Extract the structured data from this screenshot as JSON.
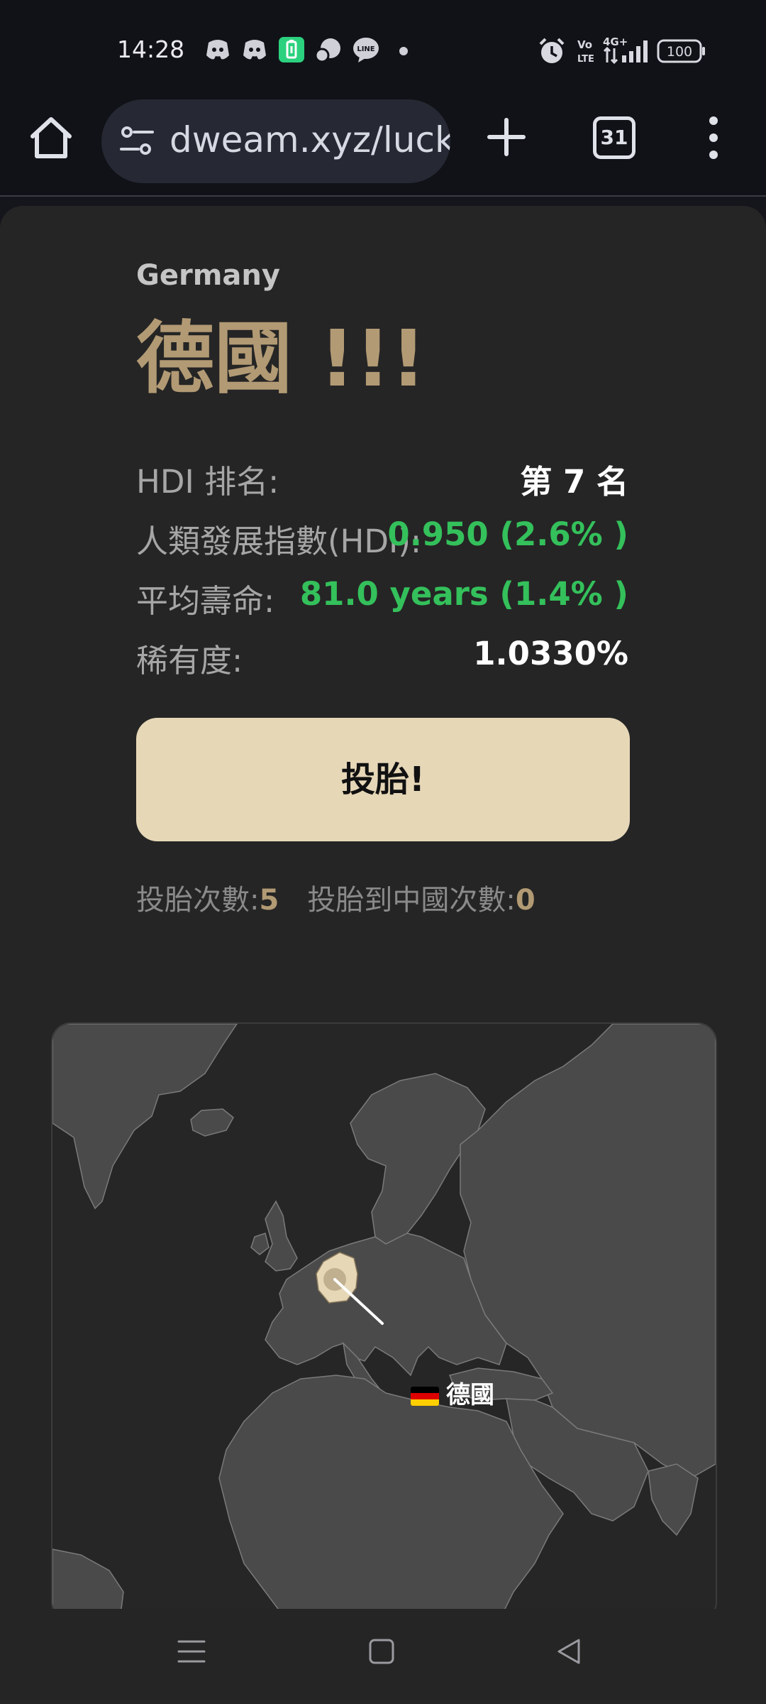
{
  "status_bar": {
    "time": "14:28",
    "notification_icons": [
      "discord-icon",
      "discord-icon",
      "battery-saver-icon",
      "chat-bubble-icon",
      "line-icon"
    ],
    "battery": "100"
  },
  "browser": {
    "url": "dweam.xyz/luck",
    "tab_count": "31",
    "icons": [
      "home-icon",
      "tune-icon",
      "plus-icon",
      "more-vert-icon"
    ]
  },
  "result": {
    "country_en": "Germany",
    "country_zh": "德國 !!!"
  },
  "stats": {
    "hdi_rank_label": "HDI 排名:",
    "hdi_rank_value": "第 7 名",
    "hdi_label": "人類發展指數(HDI):",
    "hdi_value": "0.950 (2.6% )",
    "life_label": "平均壽命:",
    "life_value": "81.0 years (1.4% )",
    "rarity_label": "稀有度:",
    "rarity_value": "1.0330%"
  },
  "roll_button": "投胎!",
  "counts": {
    "rolls_label": "投胎次數:",
    "rolls_value": "5",
    "china_label": "投胎到中國次數:",
    "china_value": "0"
  },
  "map": {
    "marker_label": "德國",
    "flag": "germany-flag-icon",
    "highlight_color": "#e6d7b7"
  },
  "nav_icons": [
    "recents-icon",
    "home-nav-icon",
    "back-icon"
  ],
  "colors": {
    "accent_gold": "#b29a74",
    "positive_green": "#34c05b",
    "button_bg": "#e6d7b7"
  }
}
